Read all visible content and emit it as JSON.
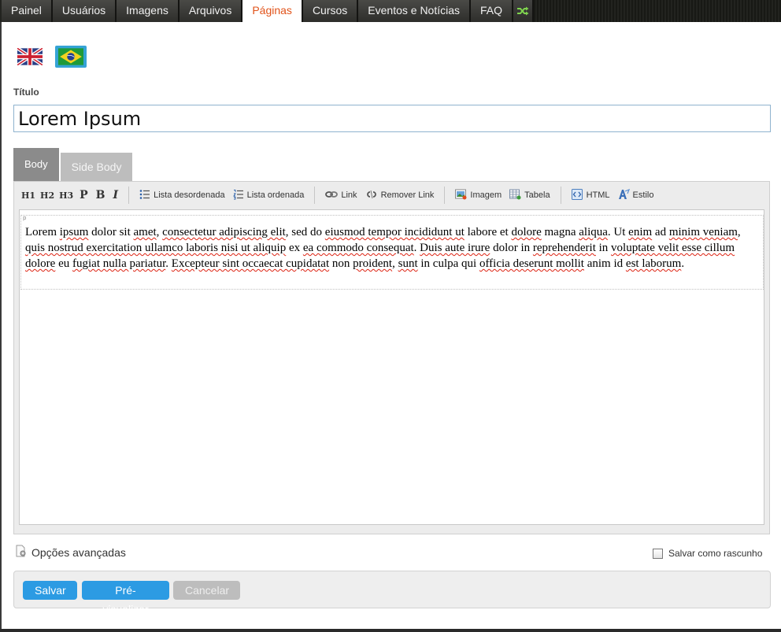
{
  "nav": {
    "items": [
      {
        "label": "Painel"
      },
      {
        "label": "Usuários"
      },
      {
        "label": "Imagens"
      },
      {
        "label": "Arquivos"
      },
      {
        "label": "Páginas",
        "active": true
      },
      {
        "label": "Cursos"
      },
      {
        "label": "Eventos e Notícias"
      },
      {
        "label": "FAQ"
      }
    ],
    "shuffle_icon": "shuffle-icon"
  },
  "languages": [
    {
      "icon": "uk-flag-icon",
      "selected": false
    },
    {
      "icon": "brazil-flag-icon",
      "selected": true
    }
  ],
  "form": {
    "title_label": "Título",
    "title_value": "Lorem Ipsum"
  },
  "tabs": {
    "body": "Body",
    "side_body": "Side Body"
  },
  "toolbar": {
    "h1": "H1",
    "h2": "H2",
    "h3": "H3",
    "p": "P",
    "bold": "B",
    "italic": "I",
    "unordered_list": "Lista desordenada",
    "ordered_list": "Lista ordenada",
    "link": "Link",
    "remove_link": "Remover Link",
    "image": "Imagem",
    "table": "Tabela",
    "html": "HTML",
    "style": "Estilo"
  },
  "editor": {
    "block_tag": "p",
    "content": "Lorem ipsum dolor sit amet, consectetur adipiscing elit, sed do eiusmod tempor incididunt ut labore et dolore magna aliqua. Ut enim ad minim veniam, quis nostrud exercitation ullamco laboris nisi ut aliquip ex ea commodo consequat. Duis aute irure dolor in reprehenderit in voluptate velit esse cillum dolore eu fugiat nulla pariatur. Excepteur sint occaecat cupidatat non proident, sunt in culpa qui officia deserunt mollit anim id est laborum."
  },
  "advanced_options": "Opções avançadas",
  "save_as_draft": {
    "label": "Salvar como rascunho",
    "checked": false
  },
  "buttons": {
    "save": "Salvar",
    "preview": "Pré-visualizar",
    "cancel": "Cancelar"
  },
  "colors": {
    "accent": "#e1531a",
    "primary_button": "#2c9be3",
    "disabled_button": "#bdbdbd"
  }
}
